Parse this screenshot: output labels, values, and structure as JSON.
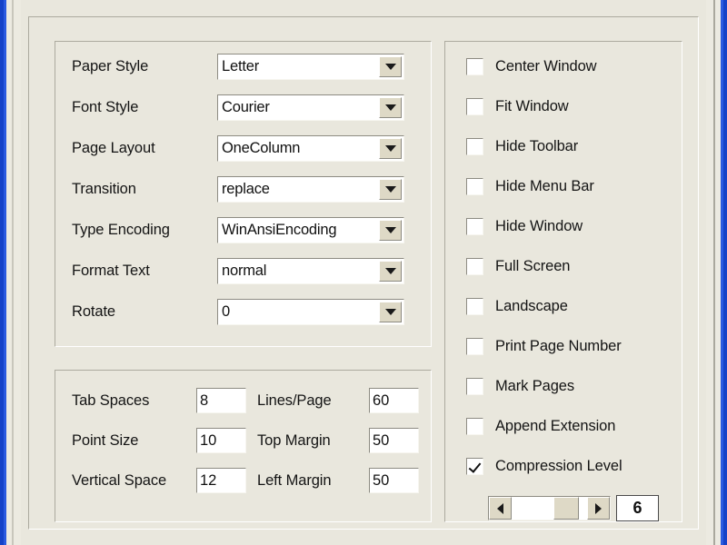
{
  "window": {
    "accent_border_color": "#1542c8",
    "face_color": "#e9e7dd",
    "field_color": "#ffffff"
  },
  "document_group": {
    "fields": [
      {
        "label": "Paper Style",
        "value": "Letter",
        "control": "combobox",
        "name": "paper-style"
      },
      {
        "label": "Font Style",
        "value": "Courier",
        "control": "combobox",
        "name": "font-style"
      },
      {
        "label": "Page Layout",
        "value": "OneColumn",
        "control": "combobox",
        "name": "page-layout"
      },
      {
        "label": "Transition",
        "value": "replace",
        "control": "combobox",
        "name": "transition"
      },
      {
        "label": "Type Encoding",
        "value": "WinAnsiEncoding",
        "control": "combobox",
        "name": "type-encoding"
      },
      {
        "label": "Format Text",
        "value": "normal",
        "control": "combobox",
        "name": "format-text"
      },
      {
        "label": "Rotate",
        "value": "0",
        "control": "combobox",
        "name": "rotate"
      }
    ],
    "dropdown_icon": "chevron-down-icon"
  },
  "metrics_group": {
    "left_column": [
      {
        "label": "Tab Spaces",
        "value": "8",
        "name": "tab-spaces"
      },
      {
        "label": "Point Size",
        "value": "10",
        "name": "point-size"
      },
      {
        "label": "Vertical Space",
        "value": "12",
        "name": "vertical-space"
      }
    ],
    "right_column": [
      {
        "label": "Lines/Page",
        "value": "60",
        "name": "lines-per-page"
      },
      {
        "label": "Top Margin",
        "value": "50",
        "name": "top-margin"
      },
      {
        "label": "Left Margin",
        "value": "50",
        "name": "left-margin"
      }
    ]
  },
  "options_group": {
    "checkboxes": [
      {
        "label": "Center Window",
        "checked": false,
        "name": "center-window"
      },
      {
        "label": "Fit Window",
        "checked": false,
        "name": "fit-window"
      },
      {
        "label": "Hide Toolbar",
        "checked": false,
        "name": "hide-toolbar"
      },
      {
        "label": "Hide Menu Bar",
        "checked": false,
        "name": "hide-menu-bar"
      },
      {
        "label": "Hide Window",
        "checked": false,
        "name": "hide-window"
      },
      {
        "label": "Full Screen",
        "checked": false,
        "name": "full-screen"
      },
      {
        "label": "Landscape",
        "checked": false,
        "name": "landscape"
      },
      {
        "label": "Print Page Number",
        "checked": false,
        "name": "print-page-number"
      },
      {
        "label": "Mark Pages",
        "checked": false,
        "name": "mark-pages"
      },
      {
        "label": "Append Extension",
        "checked": false,
        "name": "append-extension"
      },
      {
        "label": "Compression Level",
        "checked": true,
        "name": "compression-level"
      }
    ],
    "compression_slider": {
      "value": "6",
      "left_arrow_icon": "triangle-left-icon",
      "right_arrow_icon": "triangle-right-icon"
    }
  }
}
